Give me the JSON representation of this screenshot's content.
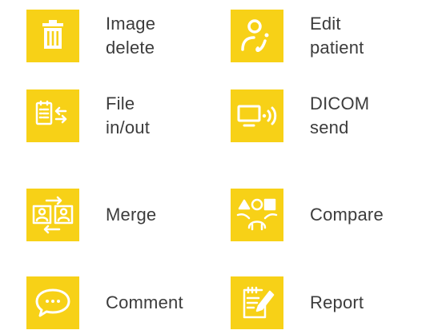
{
  "tiles": [
    {
      "id": "image-delete",
      "icon": "trash-icon",
      "lines": [
        "Image",
        "delete"
      ]
    },
    {
      "id": "edit-patient",
      "icon": "patient-edit-icon",
      "lines": [
        "Edit",
        "patient"
      ]
    },
    {
      "id": "file-inout",
      "icon": "file-transfer-icon",
      "lines": [
        "File",
        "in/out"
      ]
    },
    {
      "id": "dicom-send",
      "icon": "monitor-send-icon",
      "lines": [
        "DICOM",
        "send"
      ]
    },
    {
      "id": "merge",
      "icon": "merge-icon",
      "lines": [
        "Merge"
      ]
    },
    {
      "id": "compare",
      "icon": "compare-icon",
      "lines": [
        "Compare"
      ]
    },
    {
      "id": "comment",
      "icon": "comment-icon",
      "lines": [
        "Comment"
      ]
    },
    {
      "id": "report",
      "icon": "report-icon",
      "lines": [
        "Report"
      ]
    }
  ],
  "colors": {
    "accent": "#f7d117",
    "icon": "#ffffff",
    "text": "#3c3c3c"
  }
}
